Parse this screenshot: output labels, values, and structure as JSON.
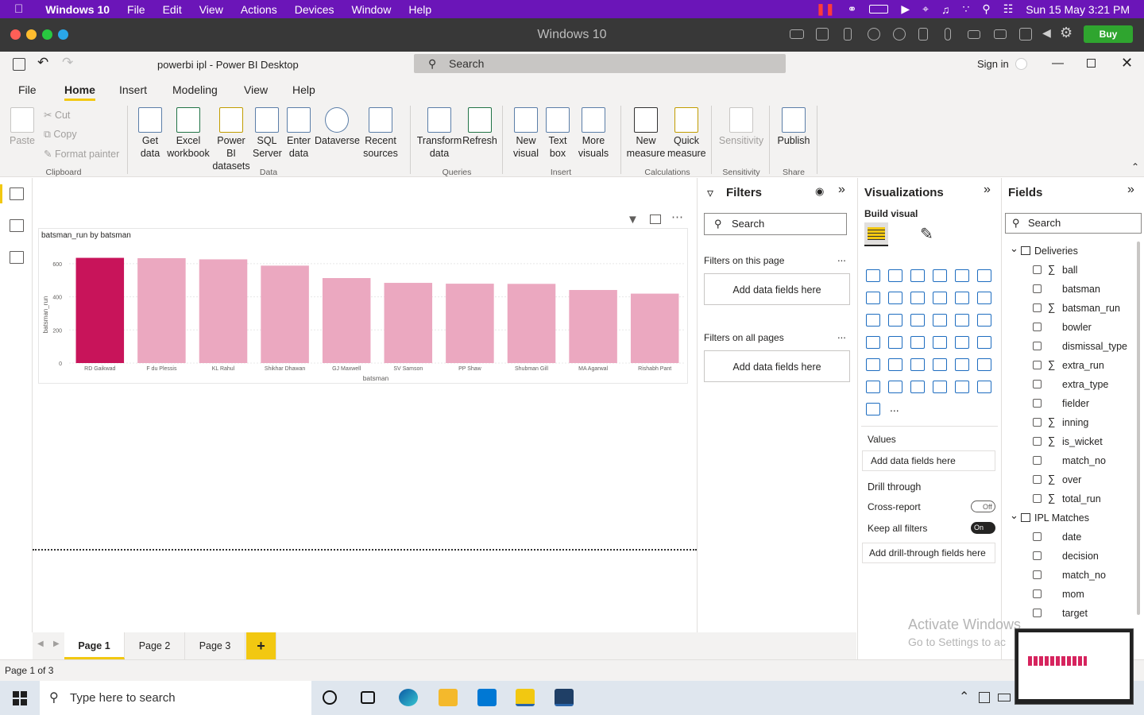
{
  "macmenu": {
    "apple": "",
    "app": "Windows 10",
    "items": [
      "File",
      "Edit",
      "View",
      "Actions",
      "Devices",
      "Window",
      "Help"
    ],
    "datetime": "Sun 15 May  3:21 PM"
  },
  "vm": {
    "title": "Windows 10",
    "buy": "Buy"
  },
  "titlebar": {
    "title": "powerbi ipl - Power BI Desktop",
    "search": "Search",
    "signin": "Sign in"
  },
  "ribbon_tabs": [
    "File",
    "Home",
    "Insert",
    "Modeling",
    "View",
    "Help"
  ],
  "ribbon": {
    "paste": "Paste",
    "cut": "Cut",
    "copy": "Copy",
    "format_painter": "Format painter",
    "get_data": "Get data",
    "excel": "Excel workbook",
    "pbi_datasets": "Power BI datasets",
    "sql": "SQL Server",
    "enter_data": "Enter data",
    "dataverse": "Dataverse",
    "recent": "Recent sources",
    "transform": "Transform data",
    "refresh": "Refresh",
    "new_visual": "New visual",
    "text_box": "Text box",
    "more_visuals": "More visuals",
    "new_measure": "New measure",
    "quick_measure": "Quick measure",
    "sensitivity": "Sensitivity",
    "publish": "Publish",
    "groups": {
      "clipboard": "Clipboard",
      "data": "Data",
      "queries": "Queries",
      "insert": "Insert",
      "calculations": "Calculations",
      "sensitivity": "Sensitivity",
      "share": "Share"
    }
  },
  "chart_data": {
    "type": "bar",
    "title": "batsman_run by batsman",
    "xlabel": "batsman",
    "ylabel": "batsman_run",
    "categories": [
      "RD Gaikwad",
      "F du Plessis",
      "KL Rahul",
      "Shikhar Dhawan",
      "GJ Maxwell",
      "SV Samson",
      "PP Shaw",
      "Shubman Gill",
      "MA Agarwal",
      "Rishabh Pant"
    ],
    "values": [
      635,
      633,
      626,
      588,
      513,
      484,
      479,
      478,
      441,
      419
    ],
    "yticks": [
      "0",
      "200",
      "400",
      "600"
    ],
    "ylim": [
      0,
      700
    ],
    "highlight_color": "#c8145a",
    "bar_color": "#eba8c0",
    "highlighted_index": 0
  },
  "filters": {
    "title": "Filters",
    "search": "Search",
    "on_page": "Filters on this page",
    "on_all": "Filters on all pages",
    "add": "Add data fields here",
    "more": "..."
  },
  "viz": {
    "title": "Visualizations",
    "build": "Build visual",
    "values": "Values",
    "add": "Add data fields here",
    "drill": "Drill through",
    "cross": "Cross-report",
    "cross_state": "Off",
    "keep": "Keep all filters",
    "keep_state": "On",
    "add_drill": "Add drill-through fields here",
    "more": "..."
  },
  "fields": {
    "title": "Fields",
    "search": "Search",
    "tables": [
      {
        "name": "Deliveries",
        "fields": [
          {
            "name": "ball",
            "sigma": "∑"
          },
          {
            "name": "batsman",
            "sigma": ""
          },
          {
            "name": "batsman_run",
            "sigma": "∑"
          },
          {
            "name": "bowler",
            "sigma": ""
          },
          {
            "name": "dismissal_type",
            "sigma": ""
          },
          {
            "name": "extra_run",
            "sigma": "∑"
          },
          {
            "name": "extra_type",
            "sigma": ""
          },
          {
            "name": "fielder",
            "sigma": ""
          },
          {
            "name": "inning",
            "sigma": "∑"
          },
          {
            "name": "is_wicket",
            "sigma": "∑"
          },
          {
            "name": "match_no",
            "sigma": ""
          },
          {
            "name": "over",
            "sigma": "∑"
          },
          {
            "name": "total_run",
            "sigma": "∑"
          }
        ]
      },
      {
        "name": "IPL Matches",
        "fields": [
          {
            "name": "date",
            "sigma": ""
          },
          {
            "name": "decision",
            "sigma": ""
          },
          {
            "name": "match_no",
            "sigma": ""
          },
          {
            "name": "mom",
            "sigma": ""
          },
          {
            "name": "target",
            "sigma": ""
          }
        ]
      }
    ]
  },
  "pages": [
    "Page 1",
    "Page 2",
    "Page 3"
  ],
  "add_page": "+",
  "status": "Page 1 of 3",
  "taskbar": {
    "search": "Type here to search"
  },
  "watermark": {
    "line1": "Activate Windows",
    "line2": "Go to Settings to ac"
  }
}
